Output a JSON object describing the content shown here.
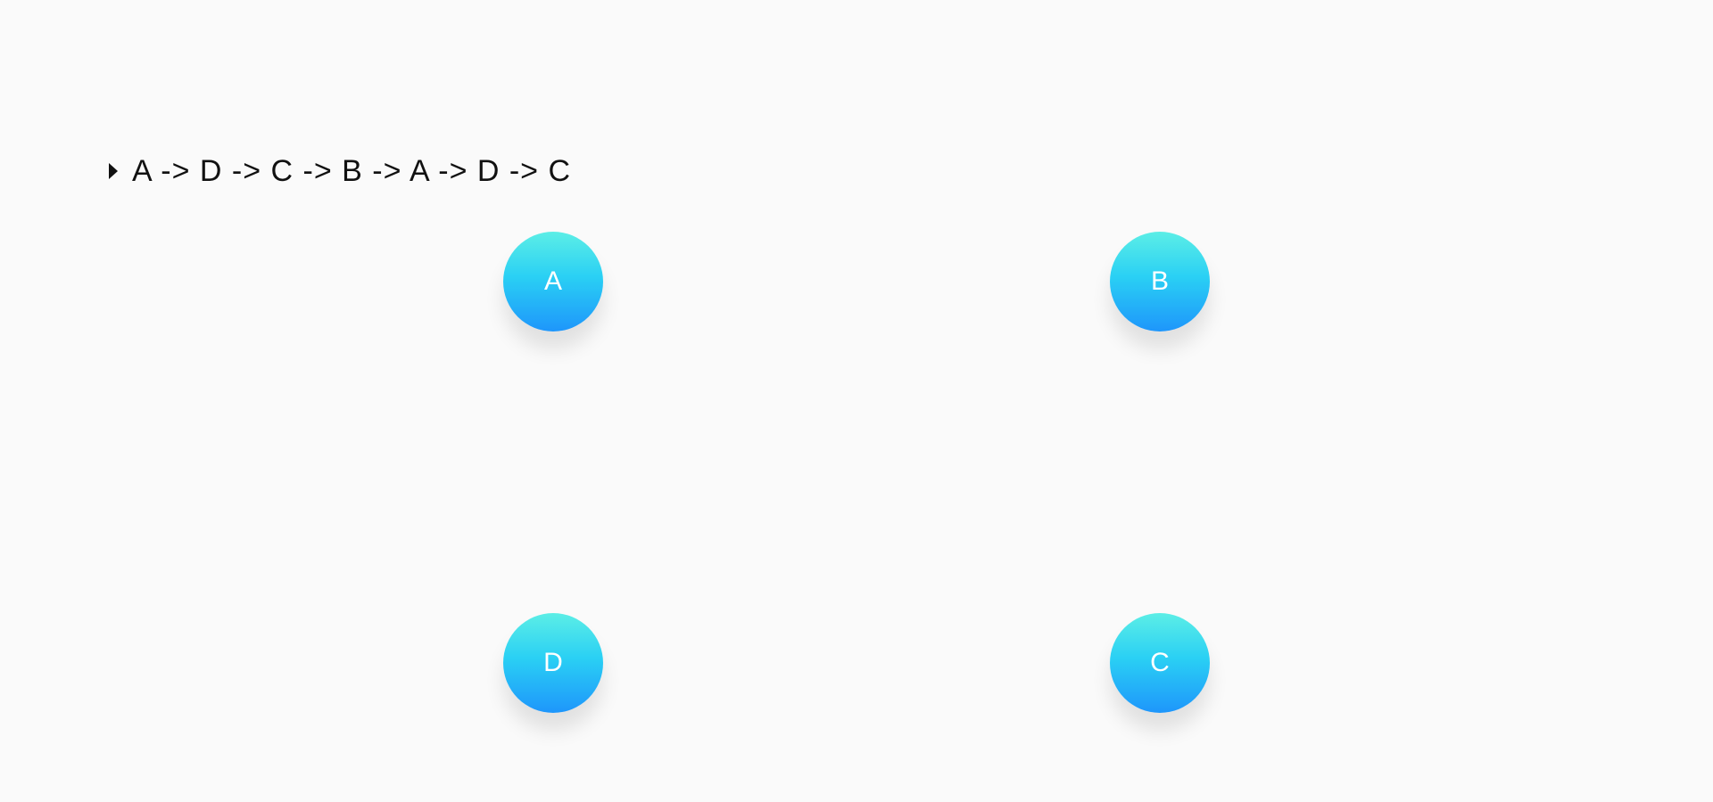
{
  "path": {
    "text": "A -> D -> C -> B -> A -> D -> C"
  },
  "nodes": {
    "a": {
      "label": "A"
    },
    "b": {
      "label": "B"
    },
    "c": {
      "label": "C"
    },
    "d": {
      "label": "D"
    }
  },
  "colors": {
    "background": "#fafafa",
    "node_gradient_top": "#5ceee6",
    "node_gradient_mid": "#2ad0f4",
    "node_gradient_bottom": "#1e96fb",
    "node_text": "#ffffff",
    "path_text": "#111111"
  },
  "icons": {
    "toggle": "caret-right-icon"
  }
}
